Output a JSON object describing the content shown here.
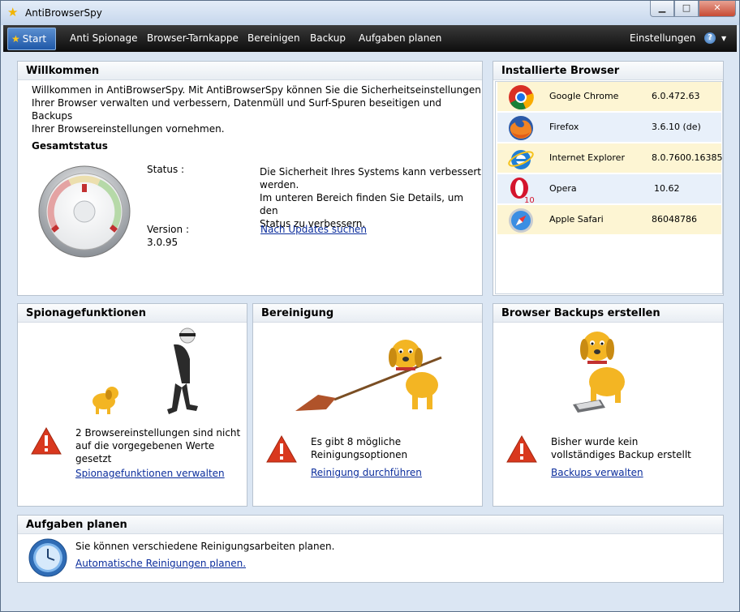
{
  "window": {
    "title": "AntiBrowserSpy",
    "minimize": "▁",
    "maximize": "□",
    "close": "✕"
  },
  "menu": {
    "start": "Start",
    "items": [
      "Anti Spionage",
      "Browser-Tarnkappe",
      "Bereinigen",
      "Backup",
      "Aufgaben planen"
    ],
    "settings": "Einstellungen",
    "help": "?"
  },
  "welcome": {
    "title": "Willkommen",
    "intro_lines": [
      "Willkommen in AntiBrowserSpy. Mit AntiBrowserSpy können Sie die Sicherheitseinstellungen",
      "Ihrer Browser verwalten und verbessern, Datenmüll und Surf-Spuren beseitigen und Backups",
      "Ihrer Browsereinstellungen vornehmen."
    ],
    "overall_status_label": "Gesamtstatus",
    "status_label": "Status :",
    "status_lines": [
      "Die Sicherheit Ihres Systems kann verbessert",
      "werden.",
      "Im unteren Bereich finden Sie Details, um den",
      "Status zu verbessern."
    ],
    "version_label": "Version :",
    "version_value": "3.0.95",
    "update_link": "Nach Updates suchen"
  },
  "browsers": {
    "title": "Installierte Browser",
    "list": [
      {
        "name": "Google Chrome",
        "version": "6.0.472.63",
        "icon": "chrome-icon"
      },
      {
        "name": "Firefox",
        "version": "3.6.10 (de)",
        "icon": "firefox-icon"
      },
      {
        "name": "Internet Explorer",
        "version": "8.0.7600.16385",
        "icon": "ie-icon"
      },
      {
        "name": "Opera",
        "version": "10.62",
        "icon": "opera-icon",
        "badge": "10"
      },
      {
        "name": "Apple Safari",
        "version": "86048786",
        "icon": "safari-icon"
      }
    ]
  },
  "spy": {
    "title": "Spionagefunktionen",
    "message_lines": [
      "2 Browsereinstellungen sind nicht",
      "auf die vorgegebenen Werte",
      "gesetzt"
    ],
    "link": "Spionagefunktionen verwalten"
  },
  "cleanup": {
    "title": "Bereinigung",
    "message_lines": [
      "Es gibt 8 mögliche",
      "Reinigungsoptionen"
    ],
    "link": "Reinigung durchführen"
  },
  "backup": {
    "title": "Browser Backups erstellen",
    "message_lines": [
      "Bisher wurde kein",
      "vollständiges Backup erstellt"
    ],
    "link": "Backups verwalten"
  },
  "schedule": {
    "title": "Aufgaben planen",
    "message": "Sie können verschiedene Reinigungsarbeiten planen.",
    "link": "Automatische Reinigungen planen."
  },
  "colors": {
    "accent": "#1f58a8",
    "link": "#0b2d9c",
    "warning": "#d9381e",
    "row_odd": "#fdf5d3",
    "row_even": "#e8f0fa"
  }
}
